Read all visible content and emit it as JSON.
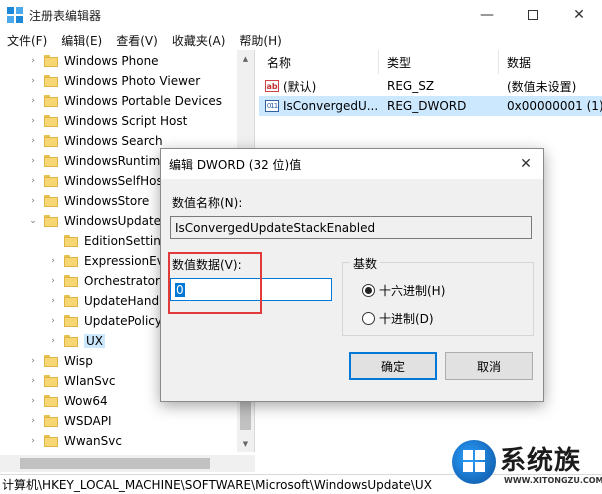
{
  "window": {
    "title": "注册表编辑器",
    "minimize_icon": "minimize-icon",
    "maximize_icon": "maximize-icon",
    "close_icon": "close-icon"
  },
  "menu": [
    "文件(F)",
    "编辑(E)",
    "查看(V)",
    "收藏夹(A)",
    "帮助(H)"
  ],
  "tree": {
    "items": [
      {
        "label": "Windows Phone",
        "indent": 0,
        "expander": "›"
      },
      {
        "label": "Windows Photo Viewer",
        "indent": 0,
        "expander": "›"
      },
      {
        "label": "Windows Portable Devices",
        "indent": 0,
        "expander": "›"
      },
      {
        "label": "Windows Script Host",
        "indent": 0,
        "expander": "›"
      },
      {
        "label": "Windows Search",
        "indent": 0,
        "expander": "›"
      },
      {
        "label": "WindowsRuntim",
        "indent": 0,
        "expander": "›"
      },
      {
        "label": "WindowsSelfHos",
        "indent": 0,
        "expander": "›"
      },
      {
        "label": "WindowsStore",
        "indent": 0,
        "expander": "›"
      },
      {
        "label": "WindowsUpdate",
        "indent": 0,
        "expander": "⌄"
      },
      {
        "label": "EditionSetting",
        "indent": 1,
        "expander": ""
      },
      {
        "label": "ExpressionEv",
        "indent": 1,
        "expander": "›"
      },
      {
        "label": "Orchestrator",
        "indent": 1,
        "expander": "›"
      },
      {
        "label": "UpdateHand",
        "indent": 1,
        "expander": "›"
      },
      {
        "label": "UpdatePolicy",
        "indent": 1,
        "expander": "›"
      },
      {
        "label": "UX",
        "indent": 1,
        "expander": "›",
        "selected": true
      },
      {
        "label": "Wisp",
        "indent": 0,
        "expander": "›"
      },
      {
        "label": "WlanSvc",
        "indent": 0,
        "expander": "›"
      },
      {
        "label": "Wow64",
        "indent": 0,
        "expander": "›"
      },
      {
        "label": "WSDAPI",
        "indent": 0,
        "expander": "›"
      },
      {
        "label": "WwanSvc",
        "indent": 0,
        "expander": "›"
      }
    ]
  },
  "values_pane": {
    "headers": [
      "名称",
      "类型",
      "数据"
    ],
    "rows": [
      {
        "name": "(默认)",
        "type": "REG_SZ",
        "data": "(数值未设置)",
        "icon": "string-value-icon",
        "selected": false
      },
      {
        "name": "IsConvergedU...",
        "type": "REG_DWORD",
        "data": "0x00000001 (1)",
        "icon": "binary-value-icon",
        "selected": true
      }
    ]
  },
  "status": {
    "path": "计算机\\HKEY_LOCAL_MACHINE\\SOFTWARE\\Microsoft\\WindowsUpdate\\UX"
  },
  "dialog": {
    "title": "编辑 DWORD (32 位)值",
    "name_label": "数值名称(N):",
    "name_value": "IsConvergedUpdateStackEnabled",
    "data_label": "数值数据(V):",
    "data_value": "0",
    "base_label": "基数",
    "radio_hex": "十六进制(H)",
    "radio_dec": "十进制(D)",
    "selected_base": "hex",
    "ok_label": "确定",
    "cancel_label": "取消"
  },
  "watermark": {
    "text": "系统族",
    "url": "WWW.XITONGZU.COM"
  },
  "colors": {
    "selection": "#cce8ff",
    "accent": "#0078d7",
    "highlight": "#e03a3a",
    "folder": "#f7d774"
  }
}
